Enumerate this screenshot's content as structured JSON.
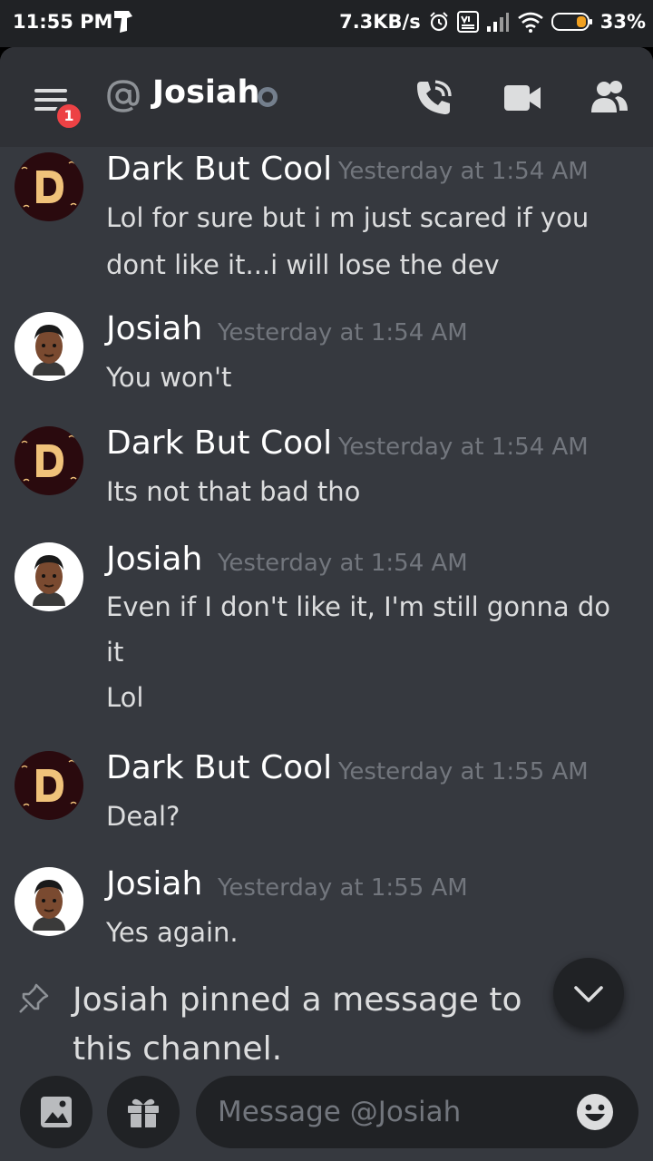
{
  "status_bar": {
    "time": "11:55 PM",
    "network_speed": "7.3KB/s",
    "battery": "33%",
    "icons": [
      "app-logo-icon",
      "alarm-icon",
      "volte-icon",
      "signal-icon",
      "wifi-icon",
      "battery-icon"
    ]
  },
  "header": {
    "unread_badge": "1",
    "channel_name": "Josiah",
    "icons": [
      "menu-icon",
      "at-icon",
      "status-offline-icon",
      "voice-call-icon",
      "video-call-icon",
      "members-icon"
    ]
  },
  "messages": [
    {
      "author": "Dark But Cool",
      "timestamp": "Yesterday at 1:54 AM",
      "lines": [
        "Lol for sure but i m just scared if you",
        "dont like it...i will lose the dev"
      ]
    },
    {
      "author": "Josiah",
      "timestamp": "Yesterday at 1:54 AM",
      "lines": [
        "You won't"
      ]
    },
    {
      "author": "Dark But Cool",
      "timestamp": "Yesterday at 1:54 AM",
      "lines": [
        "Its not that bad tho"
      ]
    },
    {
      "author": "Josiah",
      "timestamp": "Yesterday at 1:54 AM",
      "lines": [
        "Even if I don't like it, I'm still gonna do",
        "it",
        "Lol"
      ]
    },
    {
      "author": "Dark But Cool",
      "timestamp": "Yesterday at 1:55 AM",
      "lines": [
        "Deal?"
      ]
    },
    {
      "author": "Josiah",
      "timestamp": "Yesterday at 1:55 AM",
      "lines": [
        "Yes again."
      ]
    }
  ],
  "system_message": {
    "text": "Josiah pinned a message to this channel."
  },
  "composer": {
    "placeholder": "Message @Josiah",
    "icons": [
      "image-icon",
      "gift-icon",
      "emoji-icon"
    ]
  },
  "colors": {
    "background": "#36393f",
    "header": "#2f3136",
    "input": "#202225",
    "badge": "#ed4245",
    "timestamp": "#72767d"
  }
}
